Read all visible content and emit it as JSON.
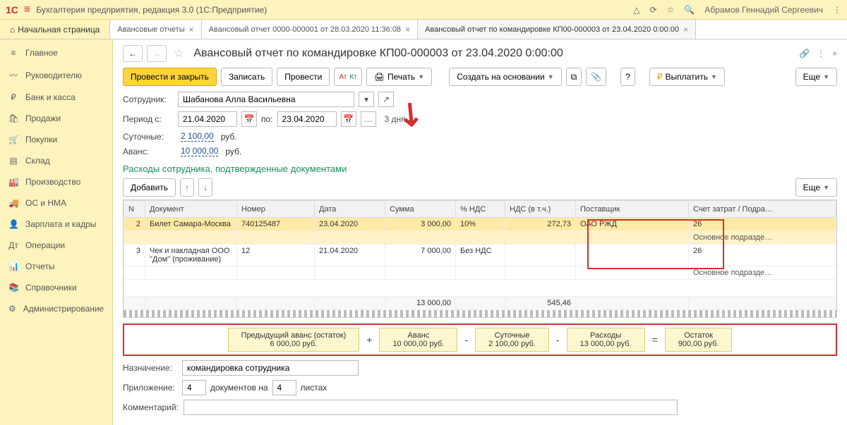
{
  "topbar": {
    "logo_main": "1С",
    "logo_sub": "≡",
    "app_title": "Бухгалтерия предприятия, редакция 3.0   (1С:Предприятие)",
    "user_name": "Абрамов Геннадий Сергеевич"
  },
  "tabs": {
    "home": "Начальная страница",
    "t1": "Авансовые отчеты",
    "t2": "Авансовый отчет 0000-000001 от 28.03.2020 11:36:08",
    "t3": "Авансовый отчет по командировке КП00-000003 от 23.04.2020 0:00:00"
  },
  "sidebar": {
    "items": [
      {
        "icon": "≡",
        "label": "Главное"
      },
      {
        "icon": "〰",
        "label": "Руководителю"
      },
      {
        "icon": "₽",
        "label": "Банк и касса"
      },
      {
        "icon": "🛍",
        "label": "Продажи"
      },
      {
        "icon": "🛒",
        "label": "Покупки"
      },
      {
        "icon": "▤",
        "label": "Склад"
      },
      {
        "icon": "🏭",
        "label": "Производство"
      },
      {
        "icon": "🚚",
        "label": "ОС и НМА"
      },
      {
        "icon": "👤",
        "label": "Зарплата и кадры"
      },
      {
        "icon": "Дт",
        "label": "Операции"
      },
      {
        "icon": "📊",
        "label": "Отчеты"
      },
      {
        "icon": "📚",
        "label": "Справочники"
      },
      {
        "icon": "⚙",
        "label": "Администрирование"
      }
    ]
  },
  "page": {
    "title": "Авансовый отчет по командировке КП00-000003 от 23.04.2020 0:00:00"
  },
  "toolbar": {
    "post_close": "Провести и закрыть",
    "save": "Записать",
    "post": "Провести",
    "print": "Печать",
    "create_based": "Создать на основании",
    "pay": "Выплатить",
    "more": "Еще",
    "help": "?"
  },
  "fields": {
    "employee_label": "Сотрудник:",
    "employee_value": "Шабанова Алла Васильевна",
    "period_from_label": "Период с:",
    "period_from": "21.04.2020",
    "period_to_label": "по:",
    "period_to": "23.04.2020",
    "period_days": "3 дня",
    "perdiem_label": "Суточные:",
    "perdiem_value": "2 100,00",
    "rub": "руб.",
    "advance_label": "Аванс:",
    "advance_value": "10 000,00",
    "purpose_label": "Назначение:",
    "purpose_value": "командировка сотрудника",
    "attach_label": "Приложение:",
    "attach_docs": "4",
    "attach_docs_label": "документов на",
    "attach_pages": "4",
    "attach_pages_label": "листах",
    "comment_label": "Комментарий:"
  },
  "expenses_title": "Расходы сотрудника, подтвержденные документами",
  "add_btn": "Добавить",
  "cols": {
    "n": "N",
    "doc": "Документ",
    "num": "Номер",
    "date": "Дата",
    "sum": "Сумма",
    "vat_pct": "% НДС",
    "vat_incl": "НДС (в т.ч.)",
    "supplier": "Поставщик",
    "acct": "Счет затрат / Подра…"
  },
  "rows": [
    {
      "n": "2",
      "doc": "Билет Самара-Москва",
      "num": "740125487",
      "date": "23.04.2020",
      "sum": "3 000,00",
      "vat_pct": "10%",
      "vat_incl": "272,73",
      "supplier": "ОАО РЖД",
      "acct": "26",
      "acct_sub": "Основное подразде…"
    },
    {
      "n": "3",
      "doc": "Чек и накладная ООО \"Дом\" (проживание)",
      "num": "12",
      "date": "21.04.2020",
      "sum": "7 000,00",
      "vat_pct": "Без НДС",
      "vat_incl": "",
      "supplier": "",
      "acct": "26",
      "acct_sub": "Основное подразде…"
    }
  ],
  "totals": {
    "sum": "13 000,00",
    "vat": "545,46"
  },
  "calc": {
    "prev_label": "Предыдущий аванс (остаток)",
    "prev_val": "6 000,00 руб.",
    "adv_label": "Аванс",
    "adv_val": "10 000,00 руб.",
    "perd_label": "Суточные",
    "perd_val": "2 100,00 руб.",
    "exp_label": "Расходы",
    "exp_val": "13 000,00 руб.",
    "rest_label": "Остаток",
    "rest_val": "900,00 руб."
  }
}
